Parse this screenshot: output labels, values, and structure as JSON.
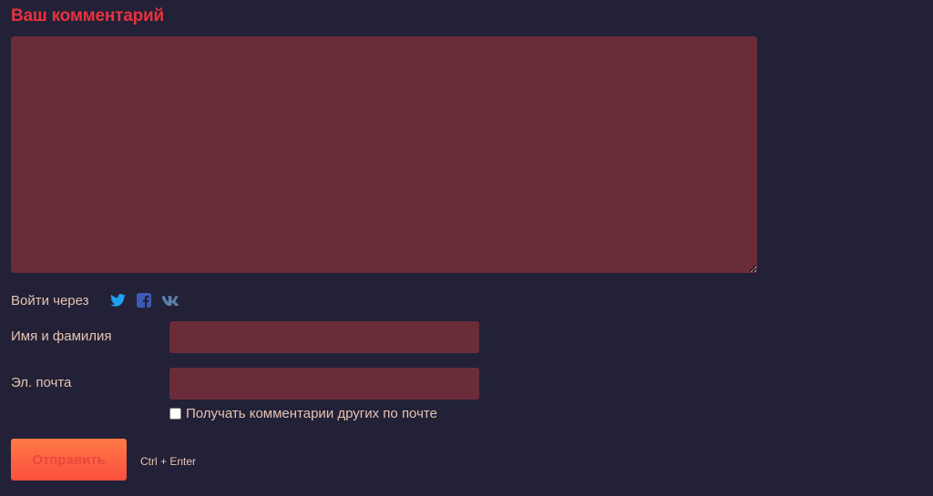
{
  "form": {
    "title": "Ваш комментарий",
    "comment_value": "",
    "login_label": "Войти через",
    "social": [
      {
        "name": "twitter-icon",
        "color": "#1da1f2"
      },
      {
        "name": "facebook-icon",
        "color": "#3b5bb5"
      },
      {
        "name": "vk-icon",
        "color": "#5c7fa7"
      }
    ],
    "name_label": "Имя и фамилия",
    "name_value": "",
    "email_label": "Эл. почта",
    "email_value": "",
    "subscribe_label": "Получать комментарии других по почте",
    "subscribe_checked": false,
    "submit_label": "Отправить",
    "shortcut_hint": "Ctrl + Enter"
  },
  "colors": {
    "background": "#222137",
    "accent": "#e8323f",
    "field": "#6b2c3a",
    "text": "#e7c3b3",
    "button_gradient_top": "#ff7a45",
    "button_gradient_bottom": "#fb4f3d"
  }
}
